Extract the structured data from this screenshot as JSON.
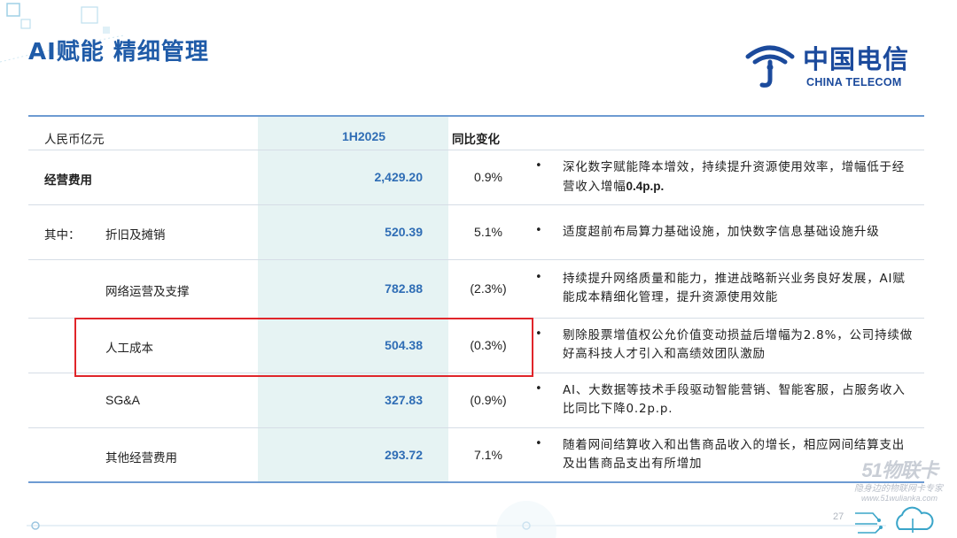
{
  "title": "AI赋能  精细管理",
  "logo": {
    "cn": "中国电信",
    "en": "CHINA TELECOM"
  },
  "table": {
    "headers": {
      "label": "人民币亿元",
      "period": "1H2025",
      "yoy": "同比变化"
    },
    "rows": [
      {
        "prefix": "",
        "label": "经营费用",
        "value": "2,429.20",
        "yoy": "0.9%",
        "comment_a": "深化数字赋能降本增效，持续提升资源使用效率，增幅低于经营收入增幅",
        "comment_b": "0.4p.p."
      },
      {
        "prefix": "其中：",
        "label": "折旧及摊销",
        "value": "520.39",
        "yoy": "5.1%",
        "comment_a": "适度超前布局算力基础设施，加快数字信息基础设施升级",
        "comment_b": ""
      },
      {
        "prefix": "",
        "label": "网络运营及支撑",
        "value": "782.88",
        "yoy": "(2.3%)",
        "comment_a": "持续提升网络质量和能力，推进战略新兴业务良好发展，AI赋能成本精细化管理，提升资源使用效能",
        "comment_b": ""
      },
      {
        "prefix": "",
        "label": "人工成本",
        "value": "504.38",
        "yoy": "(0.3%)",
        "comment_a": "剔除股票增值权公允价值变动损益后增幅为2.8%，公司持续做好高科技人才引入和高绩效团队激励",
        "comment_b": ""
      },
      {
        "prefix": "",
        "label": "SG&A",
        "value": "327.83",
        "yoy": "(0.9%)",
        "comment_a": "AI、大数据等技术手段驱动智能营销、智能客服，占服务收入比同比下降0.2p.p.",
        "comment_b": ""
      },
      {
        "prefix": "",
        "label": "其他经营费用",
        "value": "293.72",
        "yoy": "7.1%",
        "comment_a": "随着网间结算收入和出售商品收入的增长，相应网间结算支出及出售商品支出有所增加",
        "comment_b": ""
      }
    ],
    "bullet": "•"
  },
  "watermark": {
    "brand": "51物联卡",
    "slogan": "隐身边的物联网卡专家",
    "url": "www.51wulianka.com"
  },
  "page_number": "27",
  "colors": {
    "title": "#1f5ba8",
    "accent": "#2f6db5",
    "highlight_col": "#e6f3f3",
    "red_box": "#e0252a",
    "rule": "#6d9bd2"
  }
}
